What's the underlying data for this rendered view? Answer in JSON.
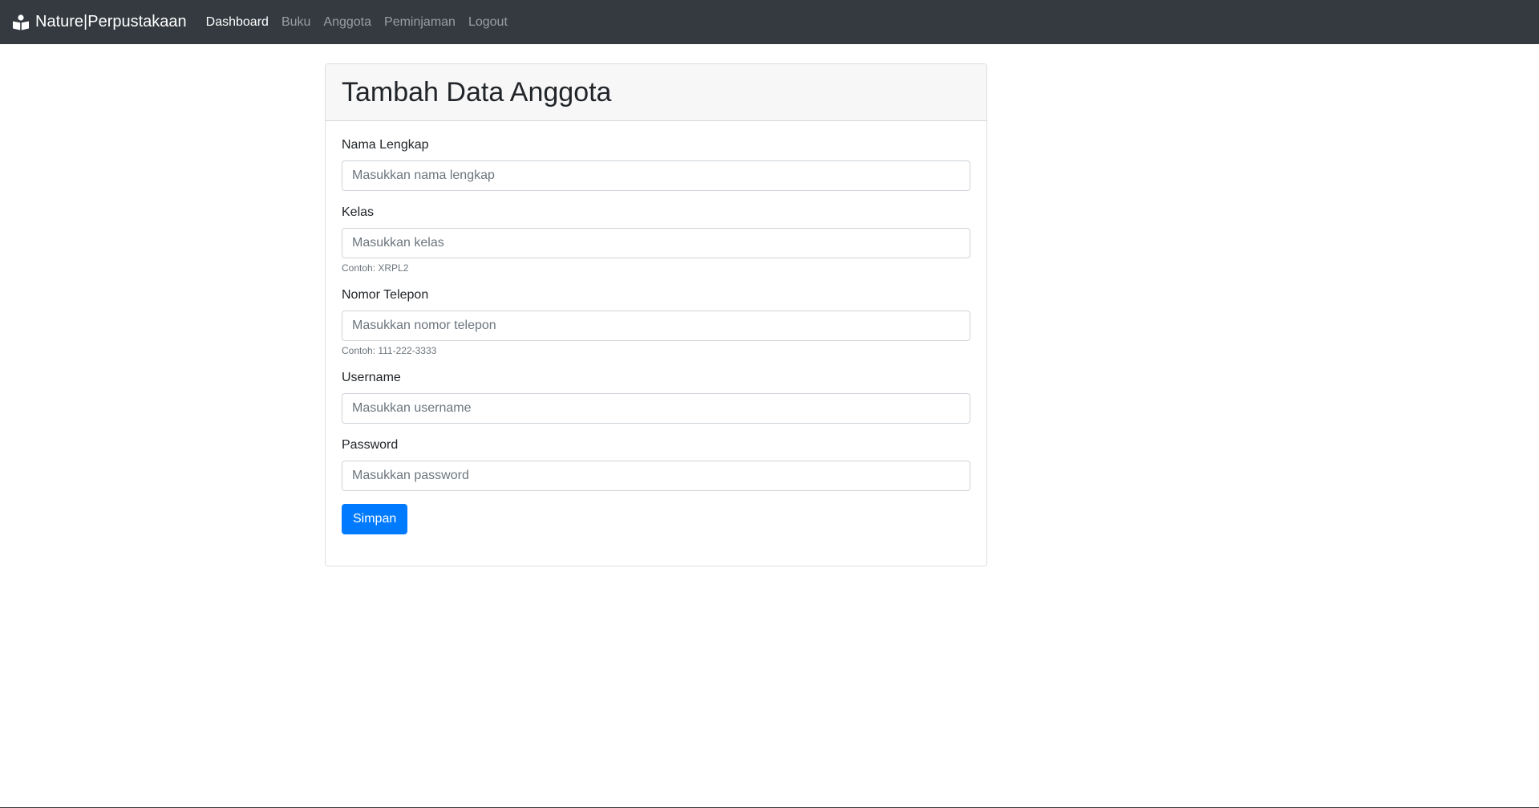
{
  "navbar": {
    "brand": "Nature|Perpustakaan",
    "brand_icon": "book-reader-icon",
    "background": "#343a40",
    "links": [
      {
        "label": "Dashboard",
        "active": true
      },
      {
        "label": "Buku",
        "active": false
      },
      {
        "label": "Anggota",
        "active": false
      },
      {
        "label": "Peminjaman",
        "active": false
      },
      {
        "label": "Logout",
        "active": false
      }
    ]
  },
  "card": {
    "title": "Tambah Data Anggota"
  },
  "form": {
    "nama": {
      "label": "Nama Lengkap",
      "placeholder": "Masukkan nama lengkap",
      "value": ""
    },
    "kelas": {
      "label": "Kelas",
      "placeholder": "Masukkan kelas",
      "value": "",
      "help": "Contoh: XRPL2"
    },
    "telepon": {
      "label": "Nomor Telepon",
      "placeholder": "Masukkan nomor telepon",
      "value": "",
      "help": "Contoh: 111-222-3333"
    },
    "username": {
      "label": "Username",
      "placeholder": "Masukkan username",
      "value": ""
    },
    "password": {
      "label": "Password",
      "placeholder": "Masukkan password",
      "value": ""
    },
    "submit_label": "Simpan",
    "submit_color": "#007bff"
  }
}
